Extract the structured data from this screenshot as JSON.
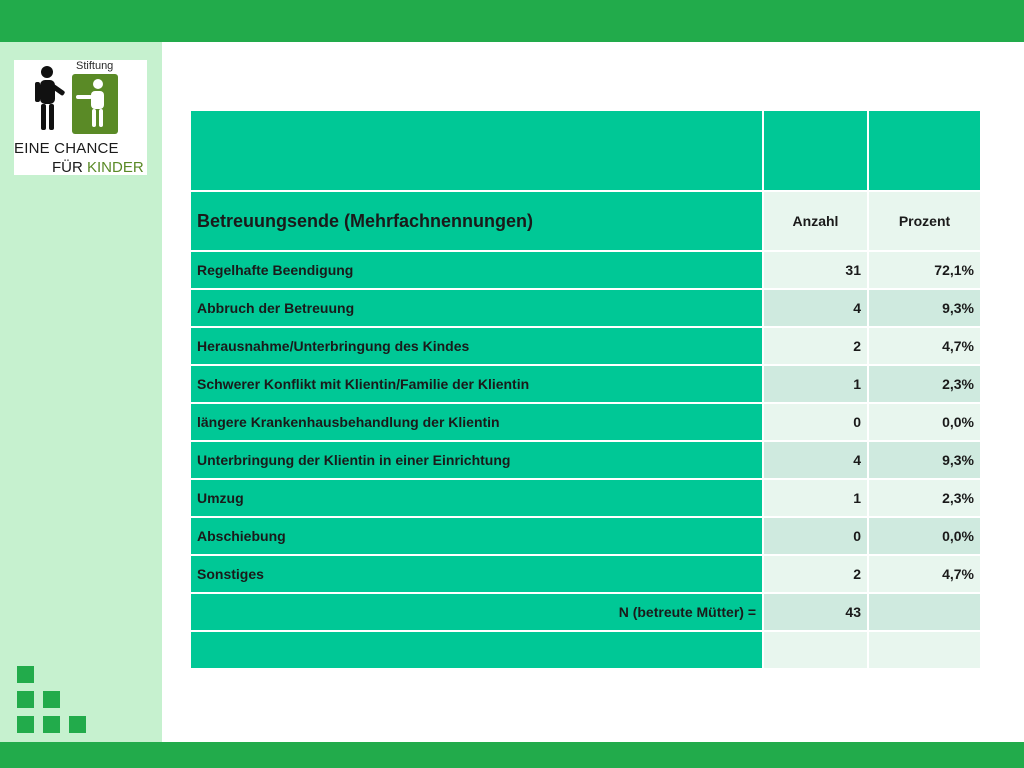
{
  "logo": {
    "stiftung": "Stiftung",
    "line1": "EINE CHANCE",
    "line2_fuer": "FÜR",
    "line2_kinder": "KINDER"
  },
  "table": {
    "title": "Betreuungsende (Mehrfachnennungen)",
    "col_count": "Anzahl",
    "col_percent": "Prozent",
    "rows": [
      {
        "label": "Regelhafte Beendigung",
        "count": "31",
        "percent": "72,1%"
      },
      {
        "label": "Abbruch der Betreuung",
        "count": "4",
        "percent": "9,3%"
      },
      {
        "label": "Herausnahme/Unterbringung des Kindes",
        "count": "2",
        "percent": "4,7%"
      },
      {
        "label": "Schwerer Konflikt mit Klientin/Familie der Klientin",
        "count": "1",
        "percent": "2,3%"
      },
      {
        "label": "längere Krankenhausbehandlung der Klientin",
        "count": "0",
        "percent": "0,0%"
      },
      {
        "label": "Unterbringung der Klientin in einer Einrichtung",
        "count": "4",
        "percent": "9,3%"
      },
      {
        "label": "Umzug",
        "count": "1",
        "percent": "2,3%"
      },
      {
        "label": "Abschiebung",
        "count": "0",
        "percent": "0,0%"
      },
      {
        "label": "Sonstiges",
        "count": "2",
        "percent": "4,7%"
      }
    ],
    "total_label": "N (betreute Mütter) =",
    "total_count": "43"
  },
  "colors": {
    "accent": "#22ab4b",
    "table_label": "#00c896",
    "sidebar": "#c6f1cf",
    "logo_green": "#5a8a26"
  }
}
